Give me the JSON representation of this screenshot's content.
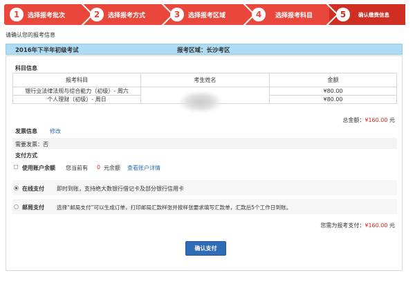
{
  "steps": [
    {
      "num": "1",
      "label": "选择报考批次"
    },
    {
      "num": "2",
      "label": "选择报考方式"
    },
    {
      "num": "3",
      "label": "选择报考区域"
    },
    {
      "num": "4",
      "label": "选择报考科目"
    },
    {
      "num": "5",
      "label": "确认缴费信息"
    }
  ],
  "prompt": "请确认您的报考信息",
  "exam": {
    "name": "2016年下半年初级考试",
    "region": "报考区域：长沙考区"
  },
  "subjects": {
    "title": "科目信息",
    "headers": [
      "报考科目",
      "考生姓名",
      "金额"
    ],
    "rows": [
      {
        "subject": "银行业法律法规与综合能力（初级）- 周六",
        "amount": "¥80.00"
      },
      {
        "subject": "个人理财（初级）- 周日",
        "amount": "¥80.00"
      }
    ],
    "total_label": "总金额：",
    "total_value": "¥160.00",
    "total_unit": "元"
  },
  "invoice": {
    "title": "发票信息",
    "edit": "修改",
    "need": "需要发票：否"
  },
  "payment": {
    "title": "支付方式",
    "balance": {
      "label": "使用账户余额",
      "text_pre": "您当前有",
      "amount": "0",
      "text_post": "元余额",
      "link": "查看账户详情"
    },
    "online": {
      "label": "在线支付",
      "desc": "即时到账，支持绝大数银行借记卡及部分银行信用卡"
    },
    "post": {
      "label": "邮局支付",
      "desc": "选择“邮局支付”可以生成订单，打印邮局汇款样张并按样张要求填写汇款单，汇款后5个工作日到账。"
    },
    "pay_total_label": "您需为报考支付：",
    "pay_total_value": "¥160.00",
    "pay_total_unit": "元"
  },
  "confirm_button": "确认支付",
  "colors": {
    "step_bar": "#e9473b",
    "step_active": "#cf2e23",
    "exam_bar": "#aedcf5",
    "price": "#d62a1f",
    "link": "#2a6db5",
    "button": "#2f6cb8"
  }
}
